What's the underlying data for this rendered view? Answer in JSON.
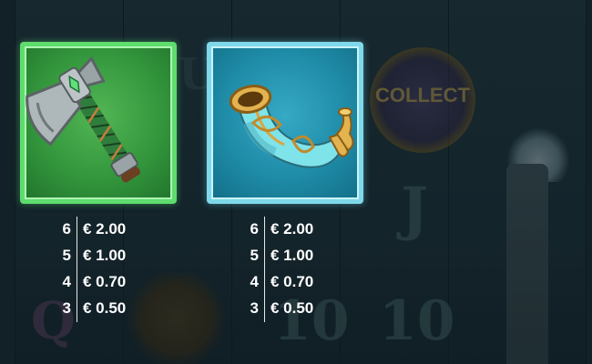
{
  "background": {
    "collect_label": "COLLECT",
    "ghost_letters": [
      "J",
      "Q",
      "10",
      "10",
      "U"
    ]
  },
  "symbols": [
    {
      "name": "axe",
      "icon": "axe-icon",
      "frame_color": "#5edc6e",
      "payouts": [
        {
          "count": "6",
          "amount": "€ 2.00"
        },
        {
          "count": "5",
          "amount": "€ 1.00"
        },
        {
          "count": "4",
          "amount": "€ 0.70"
        },
        {
          "count": "3",
          "amount": "€ 0.50"
        }
      ]
    },
    {
      "name": "horn",
      "icon": "horn-icon",
      "frame_color": "#7fd9ea",
      "payouts": [
        {
          "count": "6",
          "amount": "€ 2.00"
        },
        {
          "count": "5",
          "amount": "€ 1.00"
        },
        {
          "count": "4",
          "amount": "€ 0.70"
        },
        {
          "count": "3",
          "amount": "€ 0.50"
        }
      ]
    }
  ]
}
